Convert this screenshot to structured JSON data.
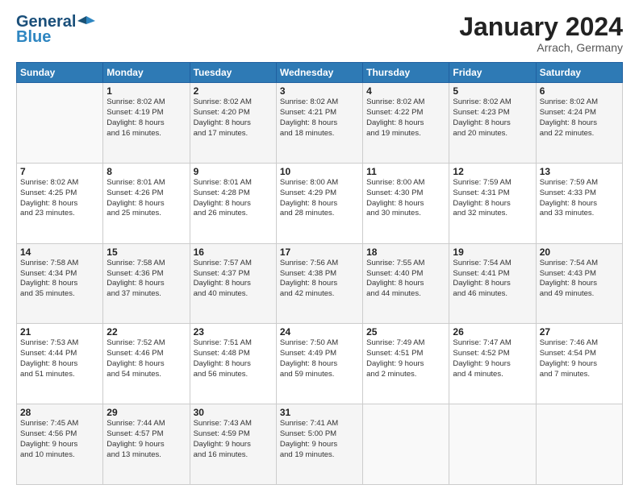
{
  "logo": {
    "line1": "General",
    "line2": "Blue"
  },
  "title": "January 2024",
  "subtitle": "Arrach, Germany",
  "days_of_week": [
    "Sunday",
    "Monday",
    "Tuesday",
    "Wednesday",
    "Thursday",
    "Friday",
    "Saturday"
  ],
  "weeks": [
    [
      {
        "day": "",
        "info": ""
      },
      {
        "day": "1",
        "info": "Sunrise: 8:02 AM\nSunset: 4:19 PM\nDaylight: 8 hours\nand 16 minutes."
      },
      {
        "day": "2",
        "info": "Sunrise: 8:02 AM\nSunset: 4:20 PM\nDaylight: 8 hours\nand 17 minutes."
      },
      {
        "day": "3",
        "info": "Sunrise: 8:02 AM\nSunset: 4:21 PM\nDaylight: 8 hours\nand 18 minutes."
      },
      {
        "day": "4",
        "info": "Sunrise: 8:02 AM\nSunset: 4:22 PM\nDaylight: 8 hours\nand 19 minutes."
      },
      {
        "day": "5",
        "info": "Sunrise: 8:02 AM\nSunset: 4:23 PM\nDaylight: 8 hours\nand 20 minutes."
      },
      {
        "day": "6",
        "info": "Sunrise: 8:02 AM\nSunset: 4:24 PM\nDaylight: 8 hours\nand 22 minutes."
      }
    ],
    [
      {
        "day": "7",
        "info": "Sunrise: 8:02 AM\nSunset: 4:25 PM\nDaylight: 8 hours\nand 23 minutes."
      },
      {
        "day": "8",
        "info": "Sunrise: 8:01 AM\nSunset: 4:26 PM\nDaylight: 8 hours\nand 25 minutes."
      },
      {
        "day": "9",
        "info": "Sunrise: 8:01 AM\nSunset: 4:28 PM\nDaylight: 8 hours\nand 26 minutes."
      },
      {
        "day": "10",
        "info": "Sunrise: 8:00 AM\nSunset: 4:29 PM\nDaylight: 8 hours\nand 28 minutes."
      },
      {
        "day": "11",
        "info": "Sunrise: 8:00 AM\nSunset: 4:30 PM\nDaylight: 8 hours\nand 30 minutes."
      },
      {
        "day": "12",
        "info": "Sunrise: 7:59 AM\nSunset: 4:31 PM\nDaylight: 8 hours\nand 32 minutes."
      },
      {
        "day": "13",
        "info": "Sunrise: 7:59 AM\nSunset: 4:33 PM\nDaylight: 8 hours\nand 33 minutes."
      }
    ],
    [
      {
        "day": "14",
        "info": "Sunrise: 7:58 AM\nSunset: 4:34 PM\nDaylight: 8 hours\nand 35 minutes."
      },
      {
        "day": "15",
        "info": "Sunrise: 7:58 AM\nSunset: 4:36 PM\nDaylight: 8 hours\nand 37 minutes."
      },
      {
        "day": "16",
        "info": "Sunrise: 7:57 AM\nSunset: 4:37 PM\nDaylight: 8 hours\nand 40 minutes."
      },
      {
        "day": "17",
        "info": "Sunrise: 7:56 AM\nSunset: 4:38 PM\nDaylight: 8 hours\nand 42 minutes."
      },
      {
        "day": "18",
        "info": "Sunrise: 7:55 AM\nSunset: 4:40 PM\nDaylight: 8 hours\nand 44 minutes."
      },
      {
        "day": "19",
        "info": "Sunrise: 7:54 AM\nSunset: 4:41 PM\nDaylight: 8 hours\nand 46 minutes."
      },
      {
        "day": "20",
        "info": "Sunrise: 7:54 AM\nSunset: 4:43 PM\nDaylight: 8 hours\nand 49 minutes."
      }
    ],
    [
      {
        "day": "21",
        "info": "Sunrise: 7:53 AM\nSunset: 4:44 PM\nDaylight: 8 hours\nand 51 minutes."
      },
      {
        "day": "22",
        "info": "Sunrise: 7:52 AM\nSunset: 4:46 PM\nDaylight: 8 hours\nand 54 minutes."
      },
      {
        "day": "23",
        "info": "Sunrise: 7:51 AM\nSunset: 4:48 PM\nDaylight: 8 hours\nand 56 minutes."
      },
      {
        "day": "24",
        "info": "Sunrise: 7:50 AM\nSunset: 4:49 PM\nDaylight: 8 hours\nand 59 minutes."
      },
      {
        "day": "25",
        "info": "Sunrise: 7:49 AM\nSunset: 4:51 PM\nDaylight: 9 hours\nand 2 minutes."
      },
      {
        "day": "26",
        "info": "Sunrise: 7:47 AM\nSunset: 4:52 PM\nDaylight: 9 hours\nand 4 minutes."
      },
      {
        "day": "27",
        "info": "Sunrise: 7:46 AM\nSunset: 4:54 PM\nDaylight: 9 hours\nand 7 minutes."
      }
    ],
    [
      {
        "day": "28",
        "info": "Sunrise: 7:45 AM\nSunset: 4:56 PM\nDaylight: 9 hours\nand 10 minutes."
      },
      {
        "day": "29",
        "info": "Sunrise: 7:44 AM\nSunset: 4:57 PM\nDaylight: 9 hours\nand 13 minutes."
      },
      {
        "day": "30",
        "info": "Sunrise: 7:43 AM\nSunset: 4:59 PM\nDaylight: 9 hours\nand 16 minutes."
      },
      {
        "day": "31",
        "info": "Sunrise: 7:41 AM\nSunset: 5:00 PM\nDaylight: 9 hours\nand 19 minutes."
      },
      {
        "day": "",
        "info": ""
      },
      {
        "day": "",
        "info": ""
      },
      {
        "day": "",
        "info": ""
      }
    ]
  ]
}
